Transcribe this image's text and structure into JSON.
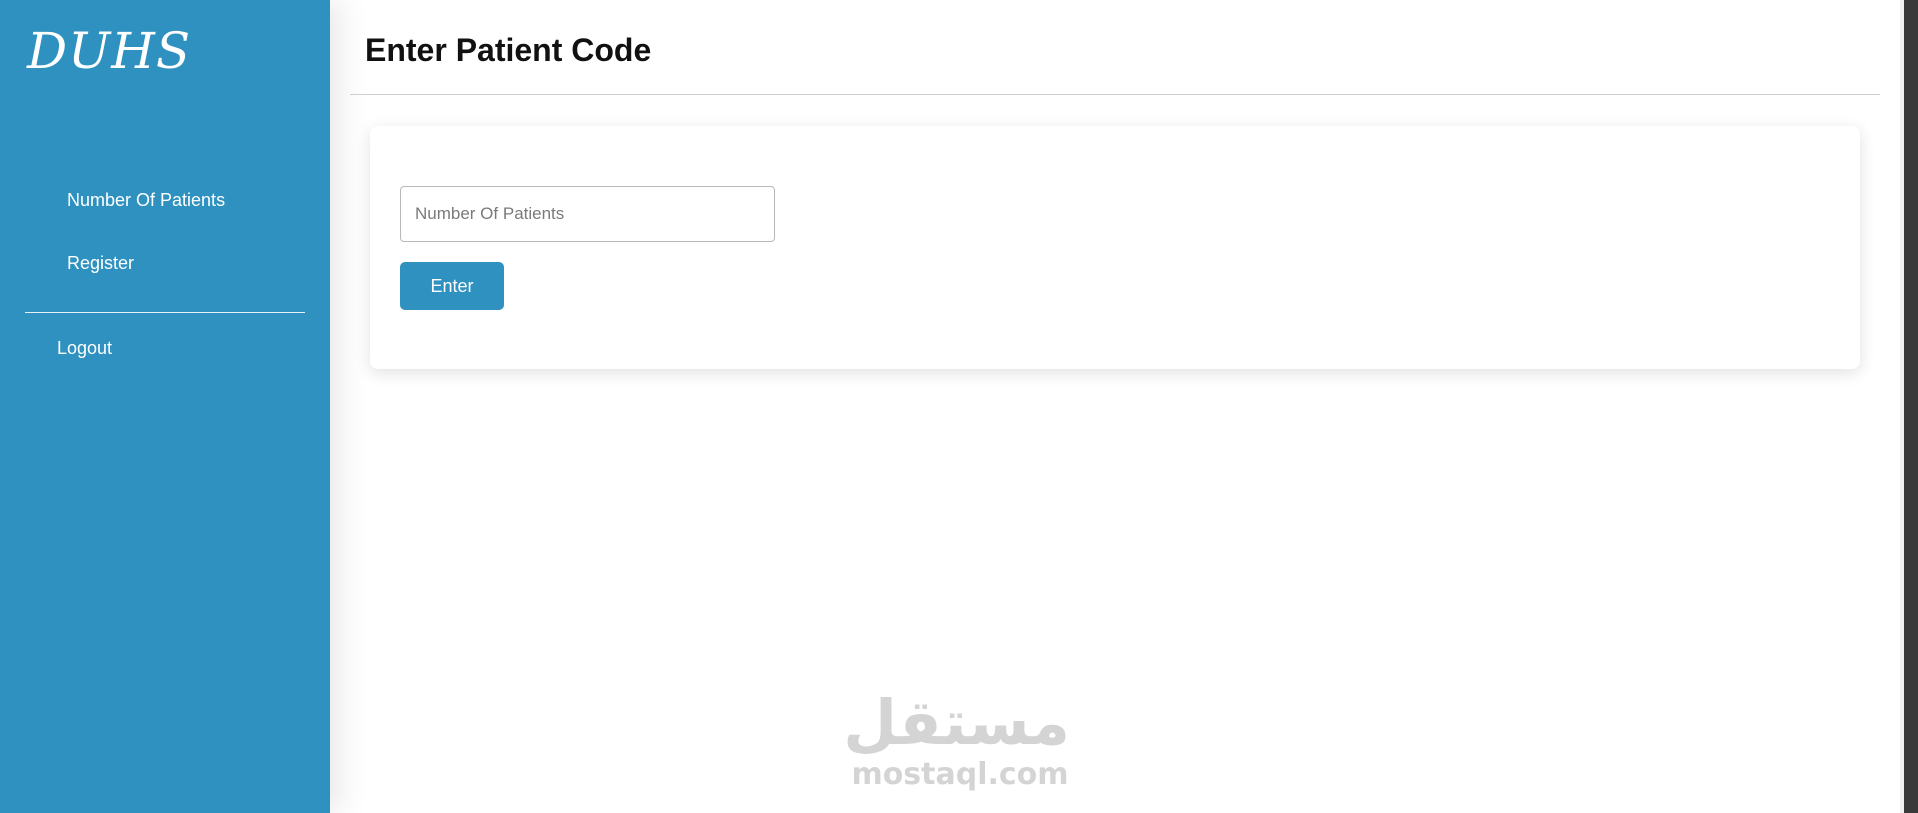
{
  "sidebar": {
    "brand": "DUHS",
    "items": [
      {
        "label": "Number Of Patients"
      },
      {
        "label": "Register"
      }
    ],
    "logout": "Logout"
  },
  "main": {
    "title": "Enter Patient Code",
    "form": {
      "input_value": "",
      "input_placeholder": "Number Of Patients",
      "submit_label": "Enter"
    }
  },
  "watermark": {
    "arabic": "مستقل",
    "latin": "mostaql.com"
  },
  "colors": {
    "accent": "#2e91bf",
    "background": "#ffffff",
    "title_text": "#111111"
  }
}
